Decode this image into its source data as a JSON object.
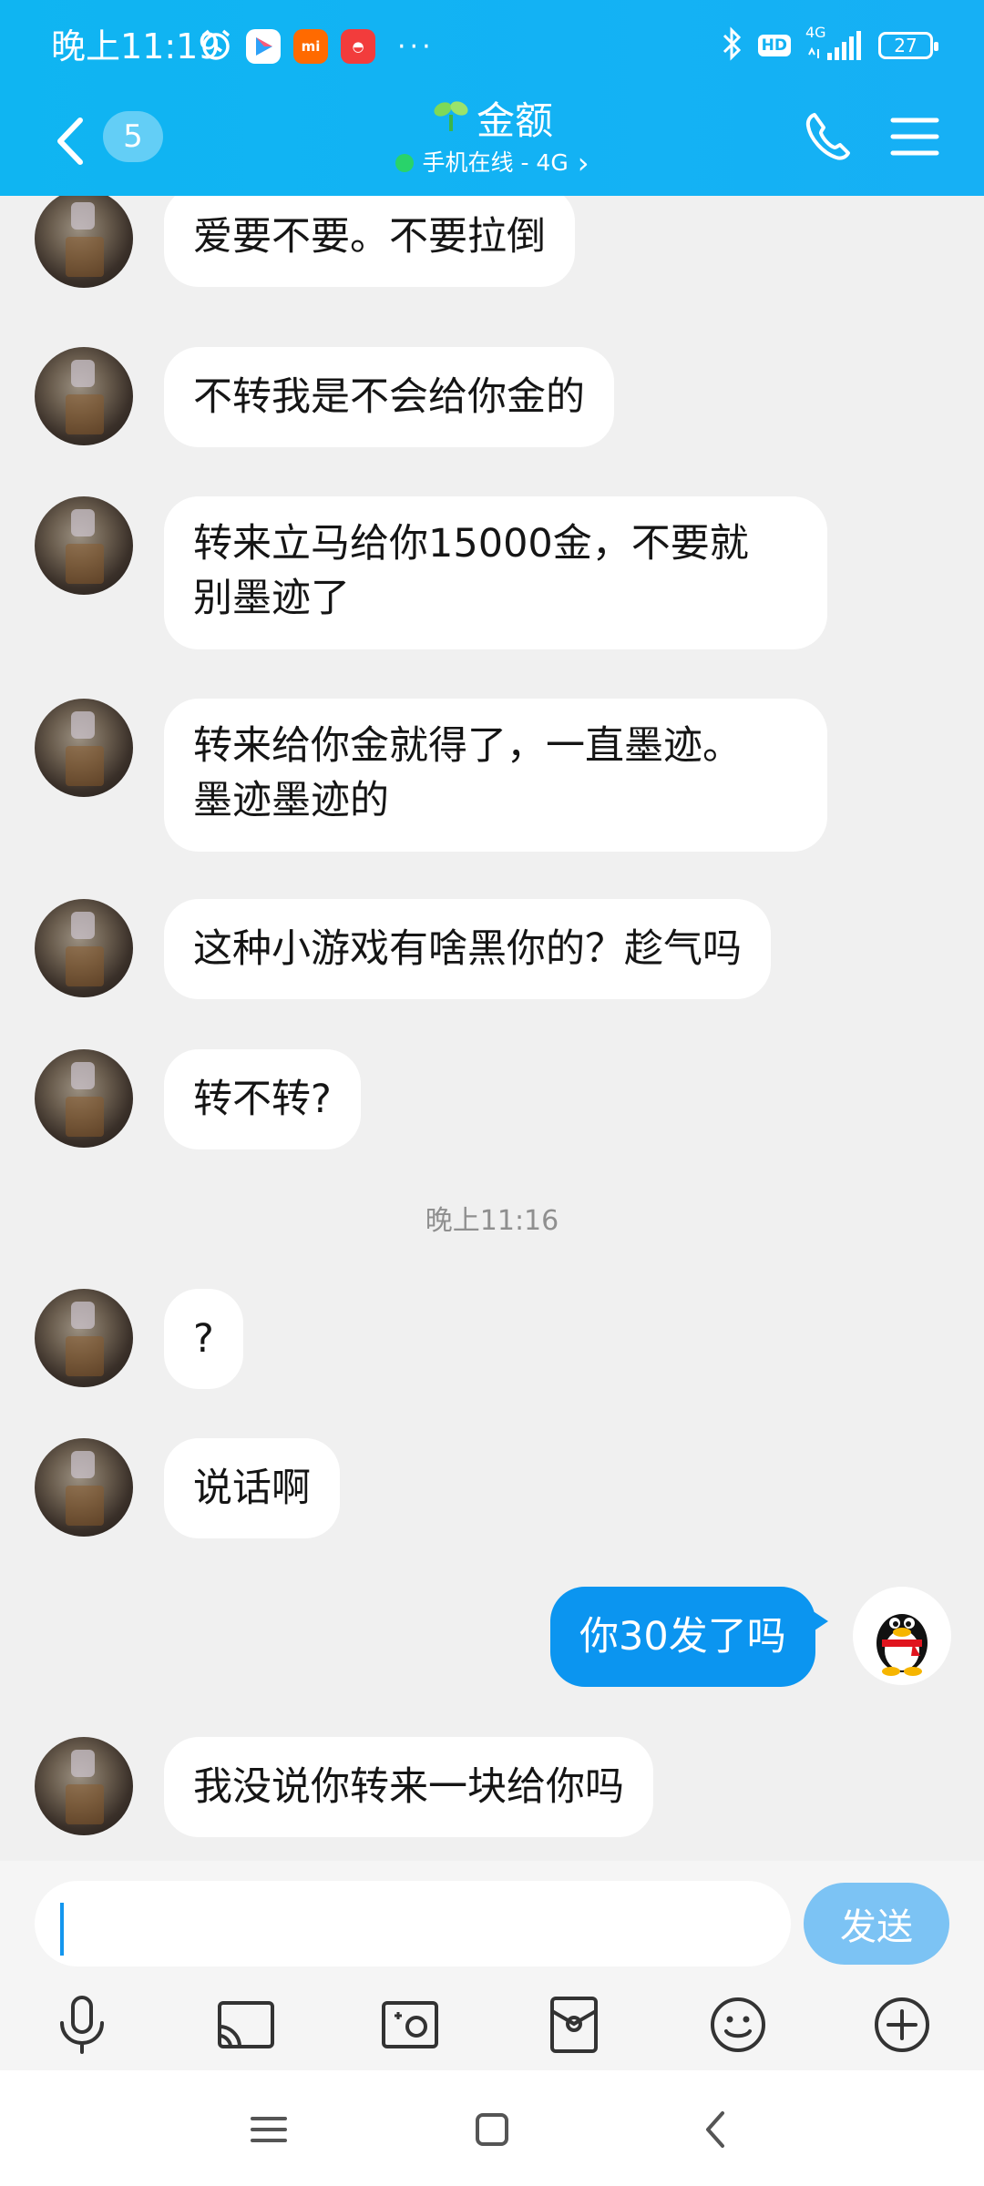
{
  "status_bar": {
    "time": "晚上11:19",
    "more": "···",
    "network": "4G",
    "hd": "HD",
    "battery": "27",
    "apps": [
      {
        "name": "play",
        "color": "#ffffff",
        "label": "▶"
      },
      {
        "name": "mi",
        "color": "#ff6a00",
        "label": "mi"
      },
      {
        "name": "app",
        "color": "#f23c3c",
        "label": "◓"
      }
    ]
  },
  "header": {
    "back_icon": "chevron-left-icon",
    "unread_count": "5",
    "title": "金额",
    "title_icon": "sprout-icon",
    "subtitle": "手机在线 - 4G",
    "subtitle_chevron": "›",
    "call_icon": "phone-icon",
    "menu_icon": "menu-icon"
  },
  "messages": [
    {
      "dir": "in",
      "text": "爱要不要。不要拉倒"
    },
    {
      "dir": "in",
      "text": "不转我是不会给你金的"
    },
    {
      "dir": "in",
      "lines": [
        "转来立马给你15000金，不要就",
        "别墨迹了"
      ]
    },
    {
      "dir": "in",
      "lines": [
        "转来给你金就得了，一直墨迹。",
        "墨迹墨迹的"
      ]
    },
    {
      "dir": "in",
      "text": "这种小游戏有啥黑你的？趁气吗"
    },
    {
      "dir": "in",
      "text": "转不转?"
    },
    {
      "dir": "time",
      "text": "晚上11:16"
    },
    {
      "dir": "in",
      "text": "?"
    },
    {
      "dir": "in",
      "text": "说话啊"
    },
    {
      "dir": "out",
      "text": "你30发了吗"
    },
    {
      "dir": "in",
      "text": "我没说你转来一块给你吗"
    }
  ],
  "input": {
    "value": "",
    "placeholder": "",
    "send_label": "发送"
  },
  "toolbar": [
    "microphone-icon",
    "screen-cast-icon",
    "photo-icon",
    "red-packet-icon",
    "emoji-icon",
    "add-icon"
  ],
  "colors": {
    "header": "#0fb5f2",
    "outgoing_bubble": "#0b95f0",
    "send_button": "#7cc3f4",
    "online": "#29d36a"
  },
  "nav": [
    "menu-icon",
    "home-icon",
    "back-icon"
  ]
}
